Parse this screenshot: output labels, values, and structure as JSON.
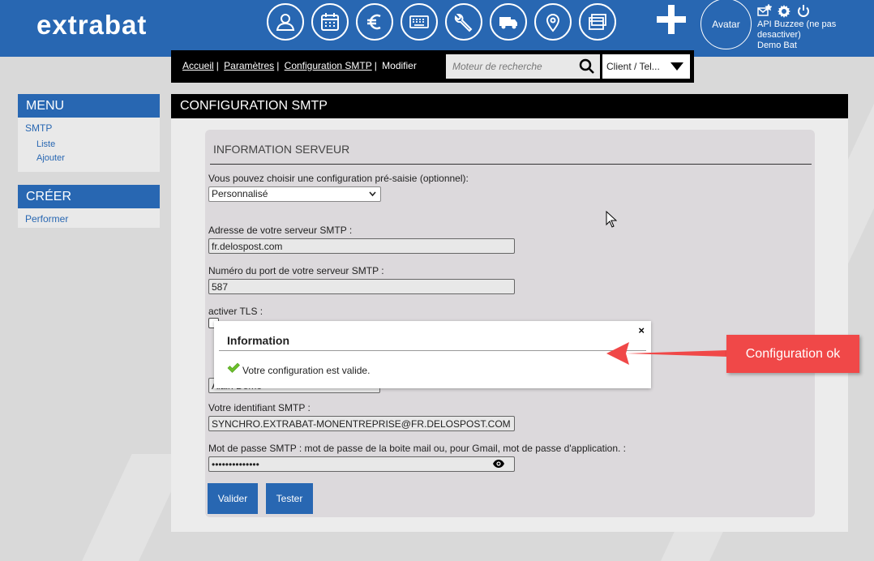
{
  "app": {
    "logo": "extrabat"
  },
  "topbar": {
    "nav_icons": [
      "contacts-icon",
      "calendar-icon",
      "euro-icon",
      "keyboard-icon",
      "wrench-icon",
      "truck-icon",
      "map-pin-icon",
      "folders-icon"
    ],
    "avatar_label": "Avatar",
    "user_line1": "API Buzzee (ne pas desactiver)",
    "user_line2": "Demo Bat"
  },
  "breadcrumb": {
    "items": [
      "Accueil",
      "Paramètres",
      "Configuration SMTP"
    ],
    "current": "Modifier"
  },
  "search": {
    "placeholder": "Moteur de recherche"
  },
  "client_select": {
    "value": "Client / Tel..."
  },
  "sidebar": {
    "menu_title": "MENU",
    "menu_section": "SMTP",
    "menu_items": [
      "Liste",
      "Ajouter"
    ],
    "create_title": "CRÉER",
    "create_items": [
      "Performer"
    ]
  },
  "main": {
    "title": "CONFIGURATION SMTP",
    "section_title": "INFORMATION SERVEUR",
    "preset_label": "Vous pouvez choisir une configuration pré-saisie (optionnel):",
    "preset_value": "Personnalisé",
    "server_label": "Adresse de votre serveur SMTP :",
    "server_value": "fr.delospost.com",
    "port_label": "Numéro du port de votre serveur SMTP :",
    "port_value": "587",
    "tls_label": "activer TLS :",
    "sender_value": "Alain Demo",
    "login_label": "Votre identifiant SMTP :",
    "login_value": "SYNCHRO.EXTRABAT-MONENTREPRISE@FR.DELOSPOST.COM",
    "password_label": "Mot de passe SMTP : mot de passe de la boite mail ou, pour Gmail, mot de passe d'application. :",
    "password_value": "••••••••••••••",
    "validate_button": "Valider",
    "test_button": "Tester"
  },
  "modal": {
    "title": "Information",
    "close": "×",
    "message": "Votre configuration est valide."
  },
  "annotation": {
    "text": "Configuration ok"
  },
  "colors": {
    "brand": "#2867b2",
    "callout": "#f04848",
    "check": "#6cbf2a"
  }
}
